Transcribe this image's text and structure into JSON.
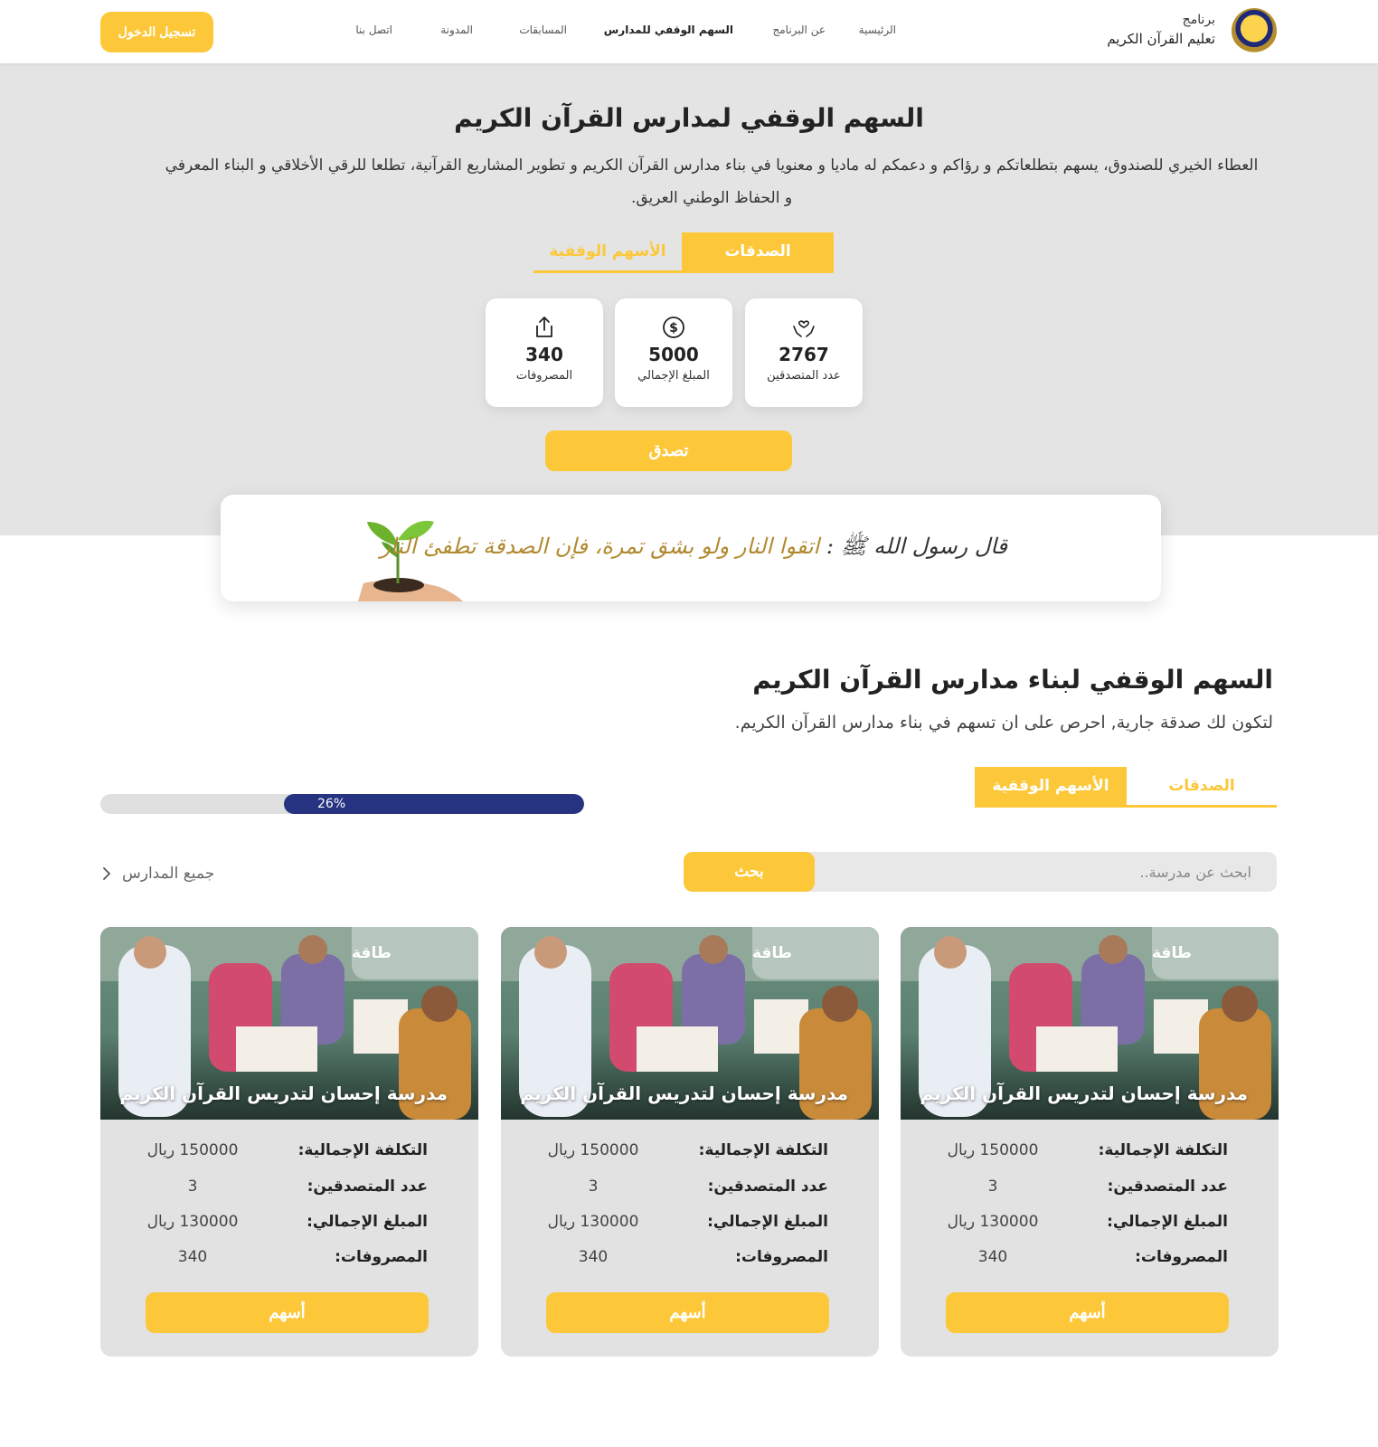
{
  "header": {
    "brand_line1": "برنامج",
    "brand_line2": "تعليم القرآن الكريم",
    "nav": [
      "الرئيسية",
      "عن البرنامج",
      "السهم الوقفي للمدارس",
      "المسابقات",
      "المدونة",
      "اتصل بنا"
    ],
    "active_nav": "السهم الوقفي للمدارس",
    "login": "تسجيل الدخول"
  },
  "hero": {
    "title": "السهم الوقفي لمدارس القرآن الكريم",
    "description": "العطاء الخيري للصندوق، يسهم بتطلعاتكم و رؤاكم و دعمكم له ماديا و معنويا في بناء مدارس القرآن الكريم و تطوير المشاريع القرآنية، تطلعا للرقي الأخلاقي و البناء المعرفي و الحفاظ الوطني العريق.",
    "tabs": {
      "active": "الصدقات",
      "inactive": "الأسهم الوقفية"
    },
    "stats": [
      {
        "icon": "hands-heart-icon",
        "value": "2767",
        "label": "عدد المتصدقين"
      },
      {
        "icon": "dollar-circle-icon",
        "value": "5000",
        "label": "المبلغ الإجمالي"
      },
      {
        "icon": "share-upload-icon",
        "value": "340",
        "label": "المصروفات"
      }
    ],
    "donate_button": "تصدق"
  },
  "banner": {
    "quote_lead": "قال رسول الله ﷺ :",
    "quote_text": "اتقوا النار ولو بشق تمرة، فإن الصدقة تطفئ النار",
    "icon": "plant-in-hand-icon"
  },
  "section": {
    "title": "السهم الوقفي لبناء مدارس القرآن الكريم",
    "subtitle": "لتكون لك صدقة جارية, احرص على ان تسهم في بناء مدارس القرآن الكريم.",
    "tabs": {
      "inactive": "الصدقات",
      "active": "الأسهم الوقفية"
    },
    "progress": {
      "percent": 26,
      "label": "26%"
    },
    "search": {
      "placeholder": "ابحث عن مدرسة..",
      "button": "بحث"
    },
    "all_schools": "جميع المدارس"
  },
  "cards": [
    {
      "tag": "طاقة",
      "name": "مدرسة إحسان لتدريس القرآن الكريم",
      "rows": [
        {
          "key": "التكلفة الإجمالية:",
          "value": "150000 ريال"
        },
        {
          "key": "عدد المتصدقين:",
          "value": "3"
        },
        {
          "key": "المبلغ الإجمالي:",
          "value": "130000 ريال"
        },
        {
          "key": "المصروفات:",
          "value": "340"
        }
      ],
      "button": "أسهم"
    },
    {
      "tag": "طاقة",
      "name": "مدرسة إحسان لتدريس القرآن الكريم",
      "rows": [
        {
          "key": "التكلفة الإجمالية:",
          "value": "150000 ريال"
        },
        {
          "key": "عدد المتصدقين:",
          "value": "3"
        },
        {
          "key": "المبلغ الإجمالي:",
          "value": "130000 ريال"
        },
        {
          "key": "المصروفات:",
          "value": "340"
        }
      ],
      "button": "أسهم"
    },
    {
      "tag": "طاقة",
      "name": "مدرسة إحسان لتدريس القرآن الكريم",
      "rows": [
        {
          "key": "التكلفة الإجمالية:",
          "value": "150000 ريال"
        },
        {
          "key": "عدد المتصدقين:",
          "value": "3"
        },
        {
          "key": "المبلغ الإجمالي:",
          "value": "130000 ريال"
        },
        {
          "key": "المصروفات:",
          "value": "340"
        }
      ],
      "button": "أسهم"
    }
  ],
  "colors": {
    "accent": "#fcc83a",
    "progress_fill": "#263381",
    "hero_bg": "#e4e4e4",
    "card_bg": "#e2e2e2"
  }
}
